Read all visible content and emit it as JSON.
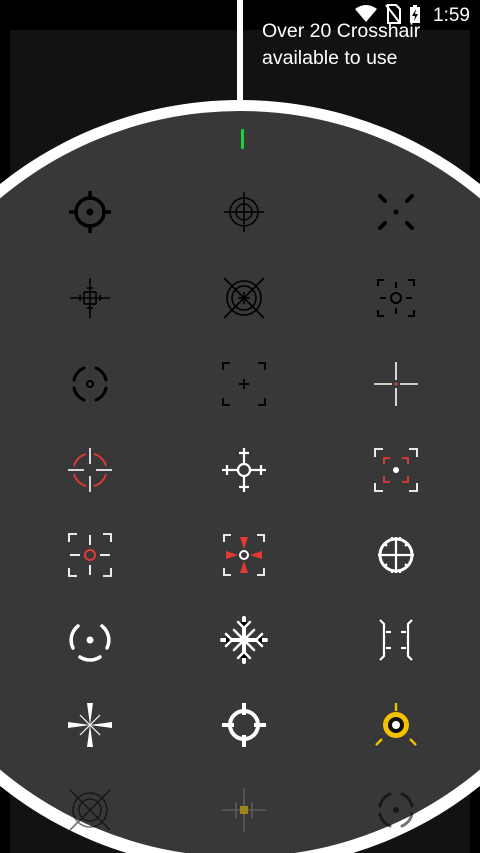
{
  "status_bar": {
    "time": "1:59",
    "icons": [
      "wifi-icon",
      "no-sim-icon",
      "battery-charging-icon"
    ]
  },
  "promo": {
    "line1": "Over 20 Crosshair",
    "line2": "available to use"
  },
  "colors": {
    "ring": "#ffffff",
    "wheel": "#383838",
    "accent_red": "#e53935",
    "accent_yellow": "#f2c200",
    "selector_green": "#1fd13a"
  },
  "crosshairs": [
    "crosshair-circle-bold",
    "crosshair-scope-thin",
    "crosshair-burst-dots",
    "crosshair-hatched-plus",
    "crosshair-x-circle",
    "crosshair-bracket-dot",
    "crosshair-broken-circle",
    "crosshair-bracket-plus",
    "crosshair-thin-cross",
    "crosshair-red-broken-circle",
    "crosshair-snowflake-cross",
    "crosshair-red-bracket",
    "crosshair-red-ring-bracket",
    "crosshair-red-arrows",
    "crosshair-gear",
    "crosshair-arc-dot",
    "crosshair-snowflake",
    "crosshair-side-brackets",
    "crosshair-star-burst",
    "crosshair-ring-ticks",
    "crosshair-yellow-target",
    "crosshair-faded-x",
    "crosshair-faded-yellow",
    "crosshair-faded-circle"
  ]
}
